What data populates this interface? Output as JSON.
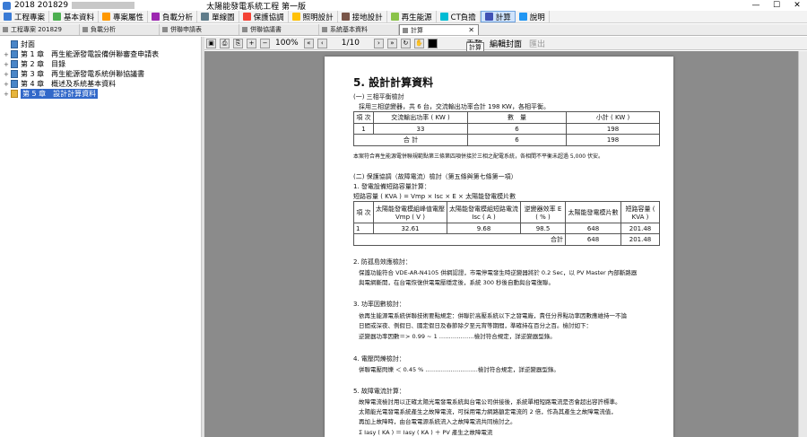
{
  "window": {
    "title_prefix": "2018 201829",
    "title": "太陽能發電系統工程 第一版",
    "min": "—",
    "max": "☐",
    "close": "✕"
  },
  "menu": [
    {
      "label": "工程專案",
      "color": "#3a7bd5"
    },
    {
      "label": "基本資料",
      "color": "#4caf50"
    },
    {
      "label": "專案屬性",
      "color": "#ff9800"
    },
    {
      "label": "負載分析",
      "color": "#9c27b0"
    },
    {
      "label": "單線圖",
      "color": "#607d8b"
    },
    {
      "label": "保護協調",
      "color": "#f44336"
    },
    {
      "label": "照明設計",
      "color": "#ffc107"
    },
    {
      "label": "接地設計",
      "color": "#795548"
    },
    {
      "label": "再生能源",
      "color": "#8bc34a"
    },
    {
      "label": "CT負擔",
      "color": "#00bcd4"
    },
    {
      "label": "計算",
      "color": "#3f51b5"
    },
    {
      "label": "說明",
      "color": "#2196f3"
    }
  ],
  "tabs": [
    "工程專案 201829",
    "負載分析",
    "併聯申請表",
    "併聯協議書",
    "系統基本資料",
    "計算"
  ],
  "tab_close": "✕",
  "tree": [
    {
      "toggle": "",
      "label": "封面"
    },
    {
      "toggle": "+",
      "label": "第 1 章　再生能源發電設備併聯審查申請表"
    },
    {
      "toggle": "+",
      "label": "第 2 章　目錄"
    },
    {
      "toggle": "+",
      "label": "第 3 章　再生能源發電系統併聯協議書"
    },
    {
      "toggle": "+",
      "label": "第 4 章　概述及系統基本資料"
    },
    {
      "toggle": "+",
      "label": "第 5 章　設計計算資料"
    }
  ],
  "viewer": {
    "zoom": "100%",
    "page": "1/10",
    "tooltip": "計算",
    "btn_print": "重整",
    "btn_edit": "編輯封面",
    "btn_exit": "匯出"
  },
  "doc": {
    "heading": "5. 設計計算資料",
    "s1_title": "(一) 三相平衡檢討",
    "s1_text": "採用三相逆變器，共 6 台，交流輸出功率合計 198 KW，各相平衡。",
    "t1_head": [
      "項 次",
      "交流輸出功率 ( KW )",
      "數　量",
      "小計 ( KW )"
    ],
    "t1_row": [
      "1",
      "33",
      "6",
      "198"
    ],
    "t1_total": [
      "合 計",
      "6",
      "198"
    ],
    "s1_note": "本案符合再生能源電併聯規範點第三條第四項併接於三相之配電系統，各相間不平衡未超過 5,000 伏安。",
    "s2_title": "(二) 保護協調（故障電流）檢討（第五條與第七條第一項）",
    "s2_1": "1. 發電設備短路容量計算：",
    "s2_formula": "短路容量 ( KVA ) = Vmp × Isc × E × 太陽能發電模片數",
    "t2_head": [
      "項 次",
      "太陽能發電模組峰值電壓 Vmp ( V )",
      "太陽能發電模組短路電流 Isc ( A )",
      "逆變器效率 E ( % )",
      "太陽能發電模片數",
      "短路容量 ( KVA )"
    ],
    "t2_row": [
      "1",
      "32.61",
      "9.68",
      "98.5",
      "648",
      "201.48"
    ],
    "t2_total": [
      "合計",
      "648",
      "201.48"
    ],
    "s2_2": "2. 防孤島效應檢討：",
    "s2_2a": "保護功能符合 VDE-AR-N4105 併網認證，市電停電發生時逆變器將於 0.2 Sec，以 PV Master 內部斷路器",
    "s2_2b": "與電網斷開，在台電恢復供電電壓穩定後，系統 300 秒後自動與台電復聯。",
    "s2_3": "3. 功率因數檢討：",
    "s2_3a": "依再生能源電系統併聯技術要點規定：併聯於高壓系統以下之發電廠，責任分界點功率因數應維持一不論",
    "s2_3b": "日間或深夜、例假日、國定假日及春節除夕至元宵等期間，準確持在百分之百。檢討如下：",
    "s2_3c": "逆變器功率因數＝> 0.99 ~ 1 ………………檢討符合規定，詳逆變器型錄。",
    "s2_4": "4. 電壓閃爍檢討：",
    "s2_4a": "併聯電壓閃爍 ＜ 0.45 % ………………………檢討符合規定，詳逆變器型錄。",
    "s2_5": "5. 故障電流計算：",
    "s2_5a": "故障電流檢討用以正確太陽光電發電系統與台電公司併接後，系統單相短路電流是否會超出容許標準。",
    "s2_5b": "太陽能光電發電系統產生之故障電流，可採用電力網路額定電流的 2 倍，作為其產生之故障電流值，",
    "s2_5c": "再加上故障時，由台電電源系統流入之故障電流共同檢討之。",
    "s2_5d": "Σ Iasy ( KA ) ＝ Iasy ( KA ) ＋ PV 產生之故障電流"
  }
}
